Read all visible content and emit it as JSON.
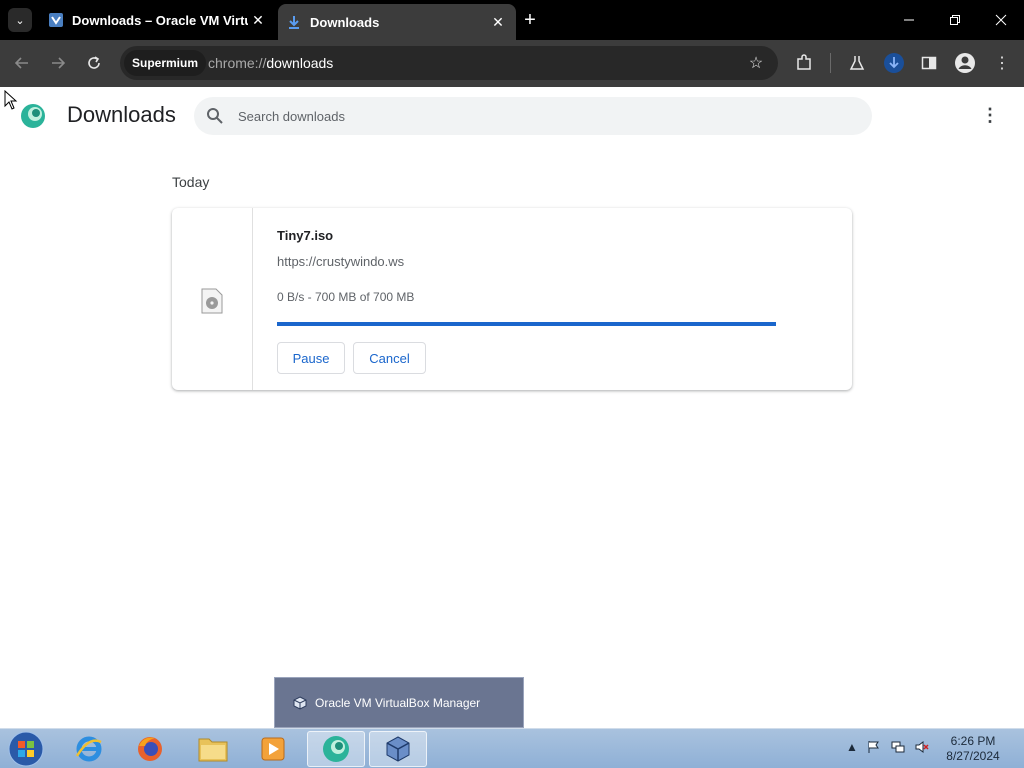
{
  "tabs": [
    {
      "title": "Downloads – Oracle VM VirtualBox",
      "active": false,
      "favicon": "virtualbox-icon"
    },
    {
      "title": "Downloads",
      "active": true,
      "favicon": "download-icon"
    }
  ],
  "omnibox": {
    "chip": "Supermium",
    "scheme": "chrome://",
    "path": "downloads"
  },
  "page": {
    "title": "Downloads",
    "search_placeholder": "Search downloads",
    "section": "Today"
  },
  "download": {
    "filename": "Tiny7.iso",
    "url": "https://crustywindo.ws",
    "status": "0 B/s - 700 MB of 700 MB",
    "progress_fraction": 1.0,
    "pause_label": "Pause",
    "cancel_label": "Cancel"
  },
  "taskbar_popup": {
    "label": "Oracle VM VirtualBox Manager"
  },
  "clock": {
    "time": "6:26 PM",
    "date": "8/27/2024"
  },
  "colors": {
    "accent": "#1a66cc",
    "toolbar": "#3c3c3c",
    "tabstrip": "#000000"
  }
}
